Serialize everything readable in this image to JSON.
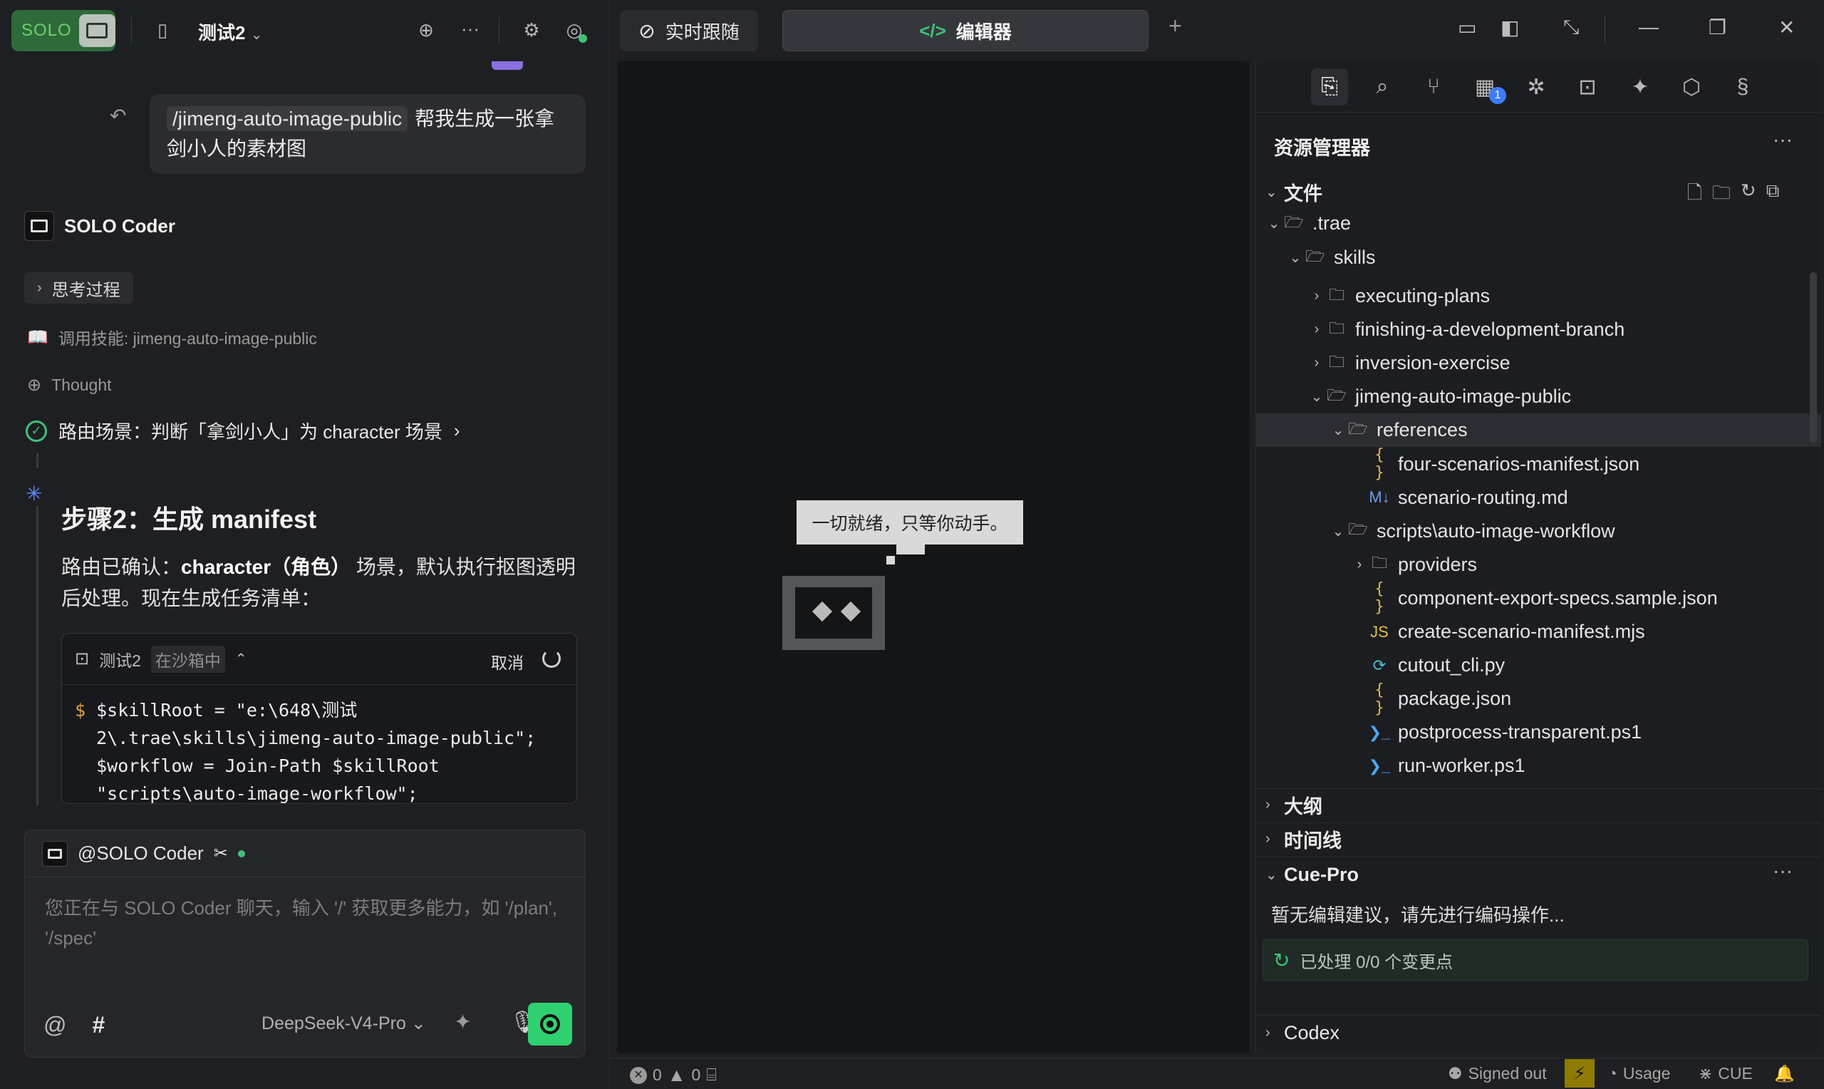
{
  "left": {
    "session_title": "测试2",
    "user_message": {
      "skill": "/jimeng-auto-image-public",
      "text": "帮我生成一张拿剑小人的素材图"
    },
    "agent_name": "SOLO Coder",
    "think_label": "思考过程",
    "skill_call": "调用技能: jimeng-auto-image-public",
    "thought_label": "Thought",
    "route_text": "路由场景：判断「拿剑小人」为 character 场景",
    "step_title": "步骤2：生成 manifest",
    "step_desc_prefix": "路由已确认：",
    "step_desc_bold": "character（角色）",
    "step_desc_suffix": "场景，默认执行抠图透明后处理。现在生成任务清单：",
    "terminal": {
      "name": "测试2",
      "tag": "在沙箱中",
      "cancel": "取消",
      "prompt": "$",
      "lines": [
        "$skillRoot = \"e:\\648\\测试",
        "2\\.trae\\skills\\jimeng-auto-image-public\";",
        "$workflow = Join-Path $skillRoot",
        "\"scripts\\auto-image-workflow\";"
      ]
    },
    "composer": {
      "mention": "@SOLO Coder",
      "placeholder": "您正在与 SOLO Coder 聊天，输入 '/' 获取更多能力，如 '/plan', '/spec'",
      "at_symbol": "@",
      "hash_symbol": "#",
      "model": "DeepSeek-V4-Pro"
    },
    "logo_text": "SOLO"
  },
  "center": {
    "tab_follow": "实时跟随",
    "tab_editor": "编辑器",
    "tab_editor_code": "</>",
    "add_tab": "+",
    "empty_bubble": "一切就绪，只等你动手。"
  },
  "explorer": {
    "title": "资源管理器",
    "more": "···",
    "files_section": "文件",
    "tree": [
      {
        "depth": 0,
        "type": "folder-open",
        "name": ".trae"
      },
      {
        "depth": 1,
        "type": "folder-open",
        "name": "skills"
      },
      {
        "depth": 2,
        "type": "folder",
        "name": "executing-plans"
      },
      {
        "depth": 2,
        "type": "folder",
        "name": "finishing-a-development-branch"
      },
      {
        "depth": 2,
        "type": "folder",
        "name": "inversion-exercise"
      },
      {
        "depth": 2,
        "type": "folder-open",
        "name": "jimeng-auto-image-public"
      },
      {
        "depth": 3,
        "type": "folder-open",
        "name": "references",
        "selected": true
      },
      {
        "depth": 4,
        "type": "json",
        "name": "four-scenarios-manifest.json"
      },
      {
        "depth": 4,
        "type": "md",
        "name": "scenario-routing.md"
      },
      {
        "depth": 3,
        "type": "folder-open",
        "name": "scripts\\auto-image-workflow"
      },
      {
        "depth": 4,
        "type": "folder",
        "name": "providers"
      },
      {
        "depth": 4,
        "type": "json",
        "name": "component-export-specs.sample.json"
      },
      {
        "depth": 4,
        "type": "js",
        "name": "create-scenario-manifest.mjs"
      },
      {
        "depth": 4,
        "type": "py",
        "name": "cutout_cli.py"
      },
      {
        "depth": 4,
        "type": "json",
        "name": "package.json"
      },
      {
        "depth": 4,
        "type": "ps",
        "name": "postprocess-transparent.ps1"
      },
      {
        "depth": 4,
        "type": "ps",
        "name": "run-worker.ps1"
      }
    ],
    "outline_section": "大纲",
    "timeline_section": "时间线",
    "cue_section": "Cue-Pro",
    "cue_message": "暂无编辑建议，请先进行编码操作...",
    "cue_status": "已处理 0/0 个变更点",
    "codex_section": "Codex",
    "activity_badge": "1"
  },
  "statusbar": {
    "errors": "0",
    "warnings": "0",
    "signed_out": "Signed out",
    "usage": "Usage",
    "cue": "CUE"
  },
  "colors": {
    "accent_green": "#2fd070",
    "badge_blue": "#3d7bff",
    "bg": "#1e1f22"
  }
}
